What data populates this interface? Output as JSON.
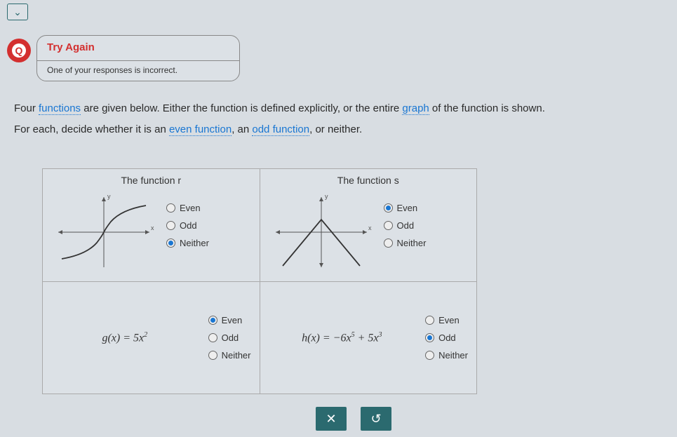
{
  "chevron": "⌄",
  "badge_letter": "Q",
  "try_again": {
    "title": "Try Again",
    "message": "One of your responses is incorrect."
  },
  "problem": {
    "line1_a": "Four ",
    "line1_link1": "functions",
    "line1_b": " are given below. Either the function is defined explicitly, or the entire ",
    "line1_link2": "graph",
    "line1_c": " of the function is shown.",
    "line2_a": "For each, decide whether it is an ",
    "line2_link1": "even function",
    "line2_b": ", an ",
    "line2_link2": "odd function",
    "line2_c": ", or neither."
  },
  "labels": {
    "even": "Even",
    "odd": "Odd",
    "neither": "Neither"
  },
  "cells": {
    "r": {
      "title": "The function r",
      "selected": "neither"
    },
    "s": {
      "title": "The function s",
      "selected": "even"
    },
    "g": {
      "formula_html": "g(x) = 5x²",
      "selected": "even"
    },
    "h": {
      "formula_html": "h(x) = −6x⁵ + 5x³",
      "selected": "odd"
    }
  },
  "buttons": {
    "close": "✕",
    "reset": "↺"
  },
  "chart_data": [
    {
      "type": "line",
      "title": "The function r",
      "description": "S-shaped curve through origin, passes from lower-left quadrant through origin to upper-right, flattening at extremes (odd-like shape)",
      "xlim": [
        -5,
        5
      ],
      "ylim": [
        -5,
        5
      ],
      "series": [
        {
          "name": "r",
          "points": [
            [
              -5,
              -3.2
            ],
            [
              -3,
              -2.8
            ],
            [
              -1,
              -1.5
            ],
            [
              0,
              0
            ],
            [
              1,
              1.5
            ],
            [
              3,
              2.8
            ],
            [
              5,
              3.2
            ]
          ]
        }
      ]
    },
    {
      "type": "line",
      "title": "The function s",
      "description": "Inverted-V (absolute-value-like) shape symmetric about the y-axis, peak above origin, arms going down to lower-left and lower-right",
      "xlim": [
        -5,
        5
      ],
      "ylim": [
        -5,
        5
      ],
      "series": [
        {
          "name": "s",
          "points": [
            [
              -5,
              -4
            ],
            [
              0,
              1.5
            ],
            [
              5,
              -4
            ]
          ]
        }
      ]
    }
  ]
}
